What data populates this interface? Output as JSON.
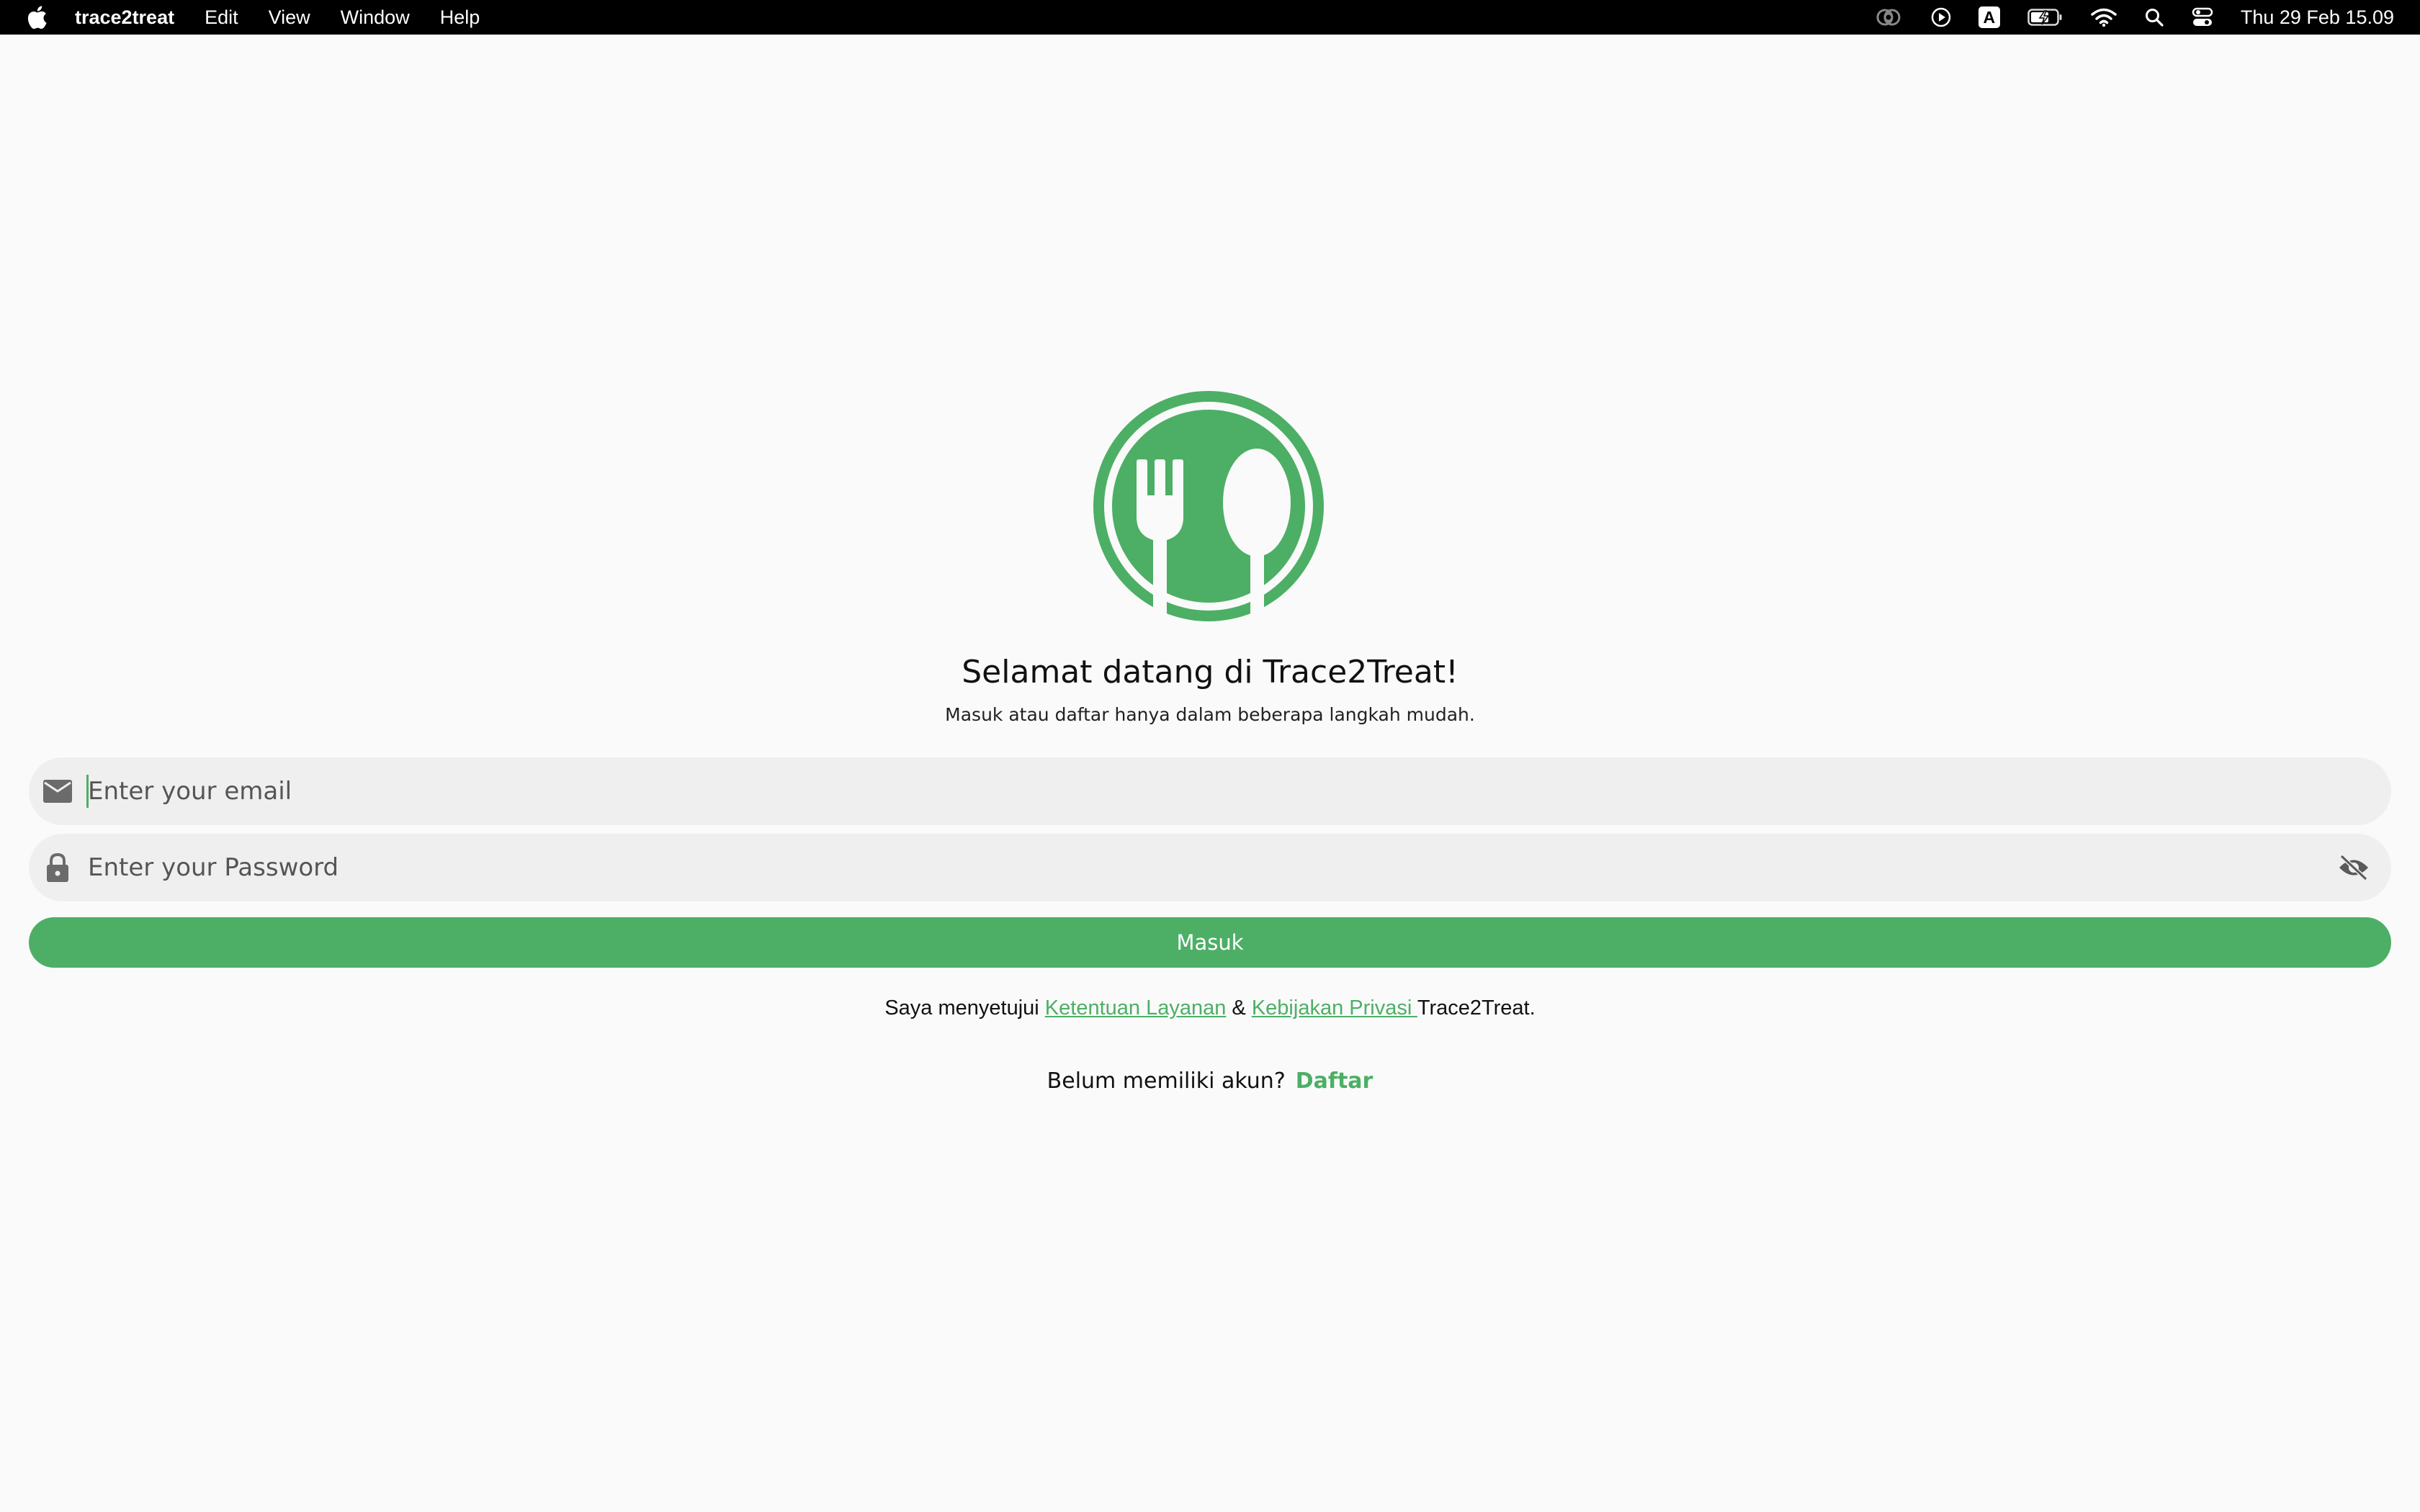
{
  "menubar": {
    "app_name": "trace2treat",
    "items": [
      "Edit",
      "View",
      "Window",
      "Help"
    ],
    "clock": "Thu 29 Feb  15.09",
    "status_icons": [
      "creative-cloud-icon",
      "play-icon",
      "input-source-icon",
      "battery-icon",
      "wifi-icon",
      "spotlight-search-icon",
      "control-center-icon"
    ],
    "input_source_letter": "A"
  },
  "login": {
    "title": "Selamat datang di Trace2Treat!",
    "subtitle": "Masuk atau daftar hanya dalam beberapa langkah mudah.",
    "email_placeholder": "Enter your email",
    "password_placeholder": "Enter your Password",
    "submit_label": "Masuk",
    "terms_prefix": "Saya menyetujui ",
    "terms_link": "Ketentuan Layanan",
    "terms_and": " & ",
    "privacy_link": "Kebijakan Privasi ",
    "terms_suffix": "Trace2Treat.",
    "register_prompt": "Belum memiliki akun?",
    "register_link": "Daftar"
  },
  "colors": {
    "accent": "#4caf65",
    "field_bg": "#efefef",
    "background": "#fafafa"
  }
}
